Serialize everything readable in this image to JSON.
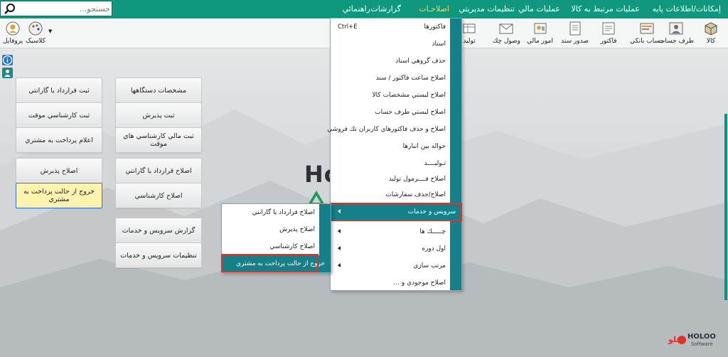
{
  "search": {
    "placeholder": "جستجو..."
  },
  "topmenu": {
    "items": [
      {
        "label": "إمكانات/اطلاعات پايه"
      },
      {
        "label": "عمليات مرتبط به کالا"
      },
      {
        "label": "عمليات مالي"
      },
      {
        "label": "تنظيمات مديريتي"
      },
      {
        "label": "اصلاحـات"
      },
      {
        "label": "گزارشات"
      },
      {
        "label": "راهنمائي"
      }
    ]
  },
  "toolbar": {
    "items": [
      {
        "label": "کالا",
        "icon": "box-icon"
      },
      {
        "label": "طرف حساب",
        "icon": "person-icon"
      },
      {
        "label": "حساب بانکي",
        "icon": "bank-icon"
      },
      {
        "label": "فاکتور",
        "icon": "invoice-icon"
      },
      {
        "label": "صدور سند",
        "icon": "document-icon"
      },
      {
        "label": "امور مالي",
        "icon": "finance-icon"
      },
      {
        "label": "وصول چك",
        "icon": "check-envelope-icon"
      },
      {
        "label": "توليد",
        "icon": "production-icon"
      }
    ],
    "left": [
      {
        "label": "كلاسيک",
        "icon": "palette-icon"
      },
      {
        "label": "پروفايل",
        "icon": "profile-icon"
      }
    ]
  },
  "buttons": {
    "col1": [
      "ثبت قرارداد يا گارانتي",
      "ثبت کارشناسي موقت",
      "اعلام پرداخت به مشتري",
      "اصلاح پذيرش",
      "خروج از حالت پرداخت به مشتري"
    ],
    "col2": [
      "مشخصات دستگاهها",
      "ثبت پذيرش",
      "ثبت مالي كارشناسي هاي موقت",
      "اصلاح قرارداد يا گارانتي",
      "اصلاح كارشناسي",
      "گزارش سرويس و خدمات",
      "تنظيمات سرويس و خدمات"
    ]
  },
  "menu": {
    "items": [
      {
        "label": "فاکتورها",
        "shortcut": "Ctrl+E"
      },
      {
        "label": "اسناد"
      },
      {
        "label": "حذف گروهي اسناد"
      },
      {
        "label": "اصلاح ساعت فاکتور / سند"
      },
      {
        "label": "اصلاح ليستي مشخصات کالا"
      },
      {
        "label": "اصلاح ليستي طرف حساب"
      },
      {
        "label": "اصلاح و حذف فاکتورهاي کاربران تك فروشي"
      },
      {
        "label": "حواله بين انبارها"
      },
      {
        "label": "تـوليــــد"
      },
      {
        "label": "اصلاح فــــرمول توليد"
      },
      {
        "label": "اصلاح/حذف سفارشات"
      },
      {
        "label": "سرويس و خدمات"
      },
      {
        "label": "چـــــك ها"
      },
      {
        "label": "اول دوره"
      },
      {
        "label": "مرتب سازي"
      },
      {
        "label": "اصلاح موجودي و ..."
      }
    ]
  },
  "submenu": {
    "items": [
      {
        "label": "اصلاح قرارداد يا گارانتي"
      },
      {
        "label": "اصلاح پذيرش"
      },
      {
        "label": "اصلاح كارشناسي"
      },
      {
        "label": "خروج از حالت پرداخت به مشتري"
      }
    ]
  },
  "brand": {
    "big": "Ho",
    "name": "HOLOO",
    "sub": "Software",
    "fa": "هلو"
  },
  "colors": {
    "teal": "#10987f",
    "menu_strip": "#16808a",
    "highlight_red": "#e0322b",
    "active_menu": "#ffd34d",
    "yellow_button": "#fff3b0"
  }
}
